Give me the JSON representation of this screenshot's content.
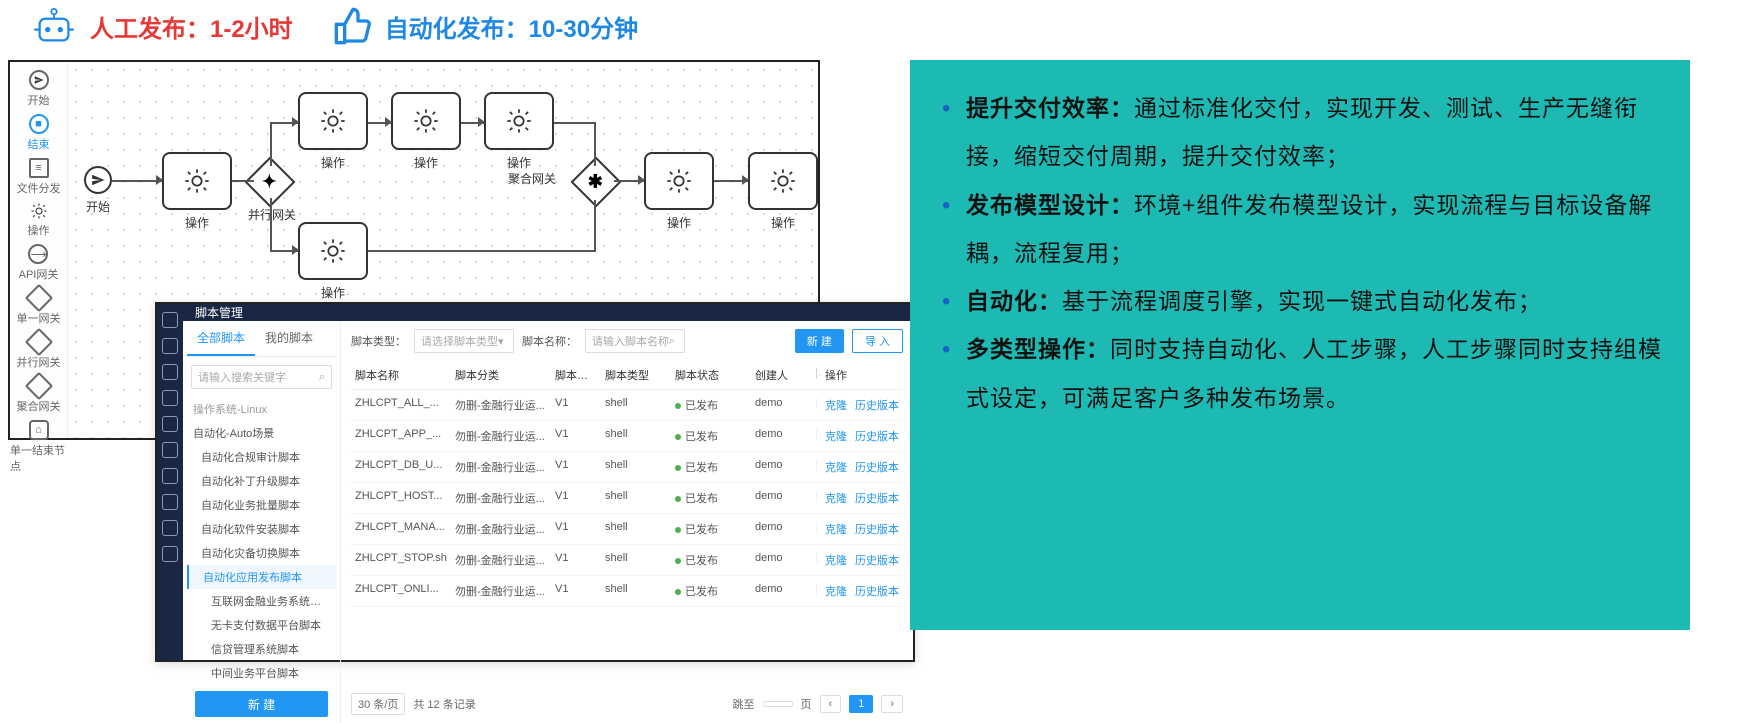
{
  "header": {
    "manual": "人工发布：1-2小时",
    "auto": "自动化发布：10-30分钟"
  },
  "flow": {
    "toolbar": [
      "开始",
      "结束",
      "文件分发",
      "操作",
      "API网关",
      "单一网关",
      "并行网关",
      "聚合网关",
      "单一结束节点"
    ],
    "start_label": "开始",
    "op_label": "操作",
    "gw_parallel": "并行网关",
    "gw_aggregate": "聚合网关"
  },
  "script": {
    "title": "脚本管理",
    "tabs": {
      "all": "全部脚本",
      "mine": "我的脚本"
    },
    "search_placeholder": "请输入搜索关键字",
    "tree": {
      "top": "操作系统-Linux",
      "group": "自动化-Auto场景",
      "items": [
        "自动化合规审计脚本",
        "自动化补丁升级脚本",
        "自动化业务批量脚本",
        "自动化软件安装脚本",
        "自动化灾备切换脚本",
        "自动化应用发布脚本"
      ],
      "sub": [
        "互联网金融业务系统…",
        "无卡支付数据平台脚本",
        "信贷管理系统脚本",
        "中间业务平台脚本"
      ],
      "new_btn": "新 建"
    },
    "filter": {
      "type_label": "脚本类型：",
      "type_ph": "请选择脚本类型",
      "name_label": "脚本名称：",
      "name_ph": "请输入脚本名称",
      "new": "新 建",
      "import": "导 入"
    },
    "columns": {
      "name": "脚本名称",
      "cat": "脚本分类",
      "ver": "脚本版本",
      "type": "脚本类型",
      "stat": "脚本状态",
      "user": "创建人",
      "op": "操作"
    },
    "rows": [
      {
        "name": "ZHLCPT_ALL_...",
        "cat": "勿删-金融行业运...",
        "ver": "V1",
        "type": "shell",
        "stat": "已发布",
        "user": "demo"
      },
      {
        "name": "ZHLCPT_APP_...",
        "cat": "勿删-金融行业运...",
        "ver": "V1",
        "type": "shell",
        "stat": "已发布",
        "user": "demo"
      },
      {
        "name": "ZHLCPT_DB_U...",
        "cat": "勿删-金融行业运...",
        "ver": "V1",
        "type": "shell",
        "stat": "已发布",
        "user": "demo"
      },
      {
        "name": "ZHLCPT_HOST...",
        "cat": "勿删-金融行业运...",
        "ver": "V1",
        "type": "shell",
        "stat": "已发布",
        "user": "demo"
      },
      {
        "name": "ZHLCPT_MANA...",
        "cat": "勿删-金融行业运...",
        "ver": "V1",
        "type": "shell",
        "stat": "已发布",
        "user": "demo"
      },
      {
        "name": "ZHLCPT_STOP.sh",
        "cat": "勿删-金融行业运...",
        "ver": "V1",
        "type": "shell",
        "stat": "已发布",
        "user": "demo"
      },
      {
        "name": "ZHLCPT_ONLI...",
        "cat": "勿删-金融行业运...",
        "ver": "V1",
        "type": "shell",
        "stat": "已发布",
        "user": "demo"
      }
    ],
    "row_ops": {
      "clone": "克隆",
      "history": "历史版本"
    },
    "pagination": {
      "size": "30 条/页",
      "total": "共 12 条记录",
      "jump": "跳至",
      "page_unit": "页",
      "current": "1"
    }
  },
  "teal": {
    "items": [
      {
        "t": "提升交付效率：",
        "b": "通过标准化交付，实现开发、测试、生产无缝衔接，缩短交付周期，提升交付效率；"
      },
      {
        "t": "发布模型设计：",
        "b": "环境+组件发布模型设计，实现流程与目标设备解耦，流程复用；"
      },
      {
        "t": "自动化：",
        "b": "基于流程调度引擎，实现一键式自动化发布；"
      },
      {
        "t": "多类型操作：",
        "b": "同时支持自动化、人工步骤，人工步骤同时支持组模式设定，可满足客户多种发布场景。"
      }
    ]
  }
}
